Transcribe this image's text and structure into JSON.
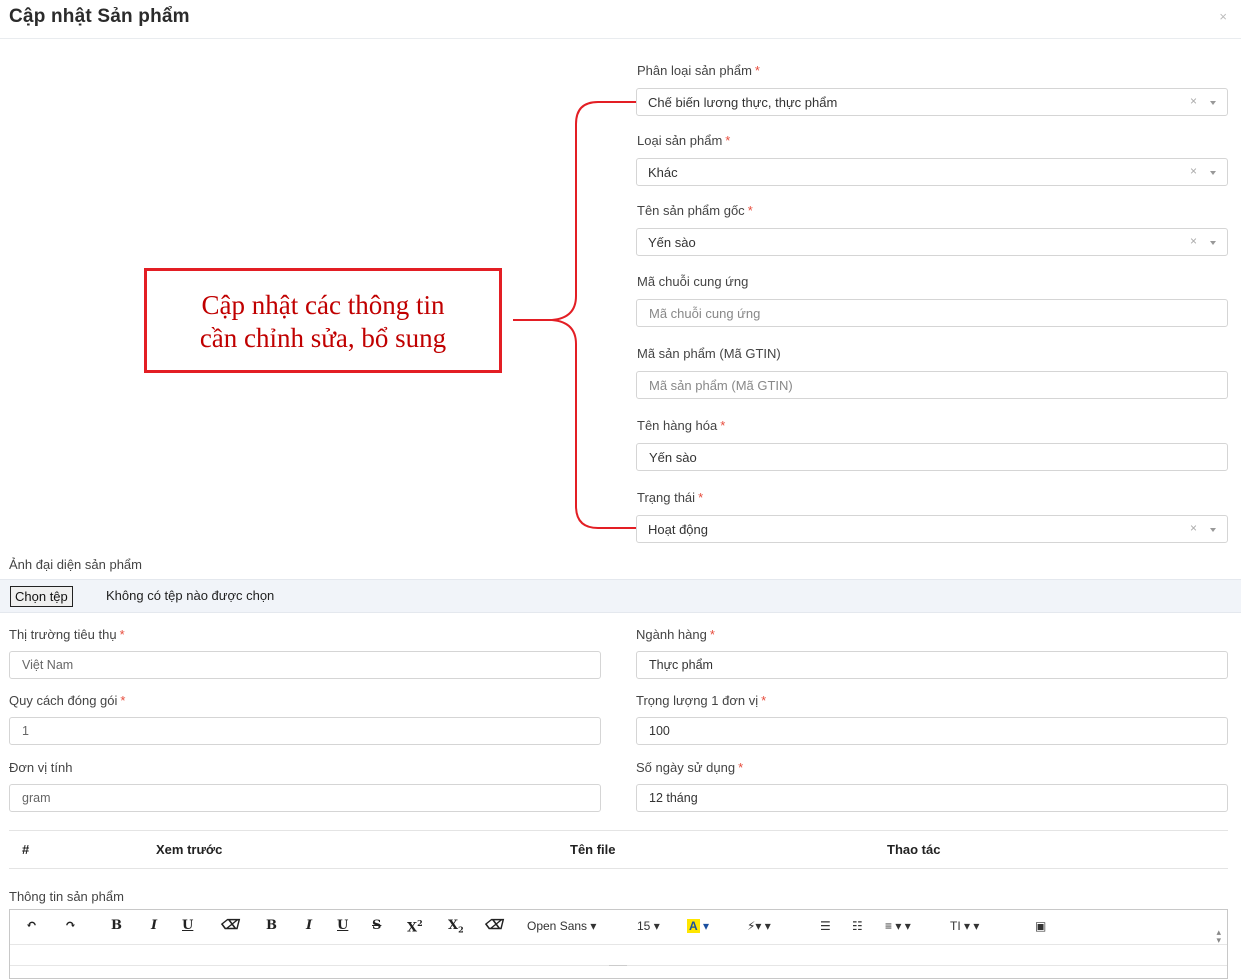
{
  "modal": {
    "title": "Cập nhật Sản phẩm",
    "close": "×"
  },
  "fields": {
    "category": {
      "label": "Phân loại sản phẩm",
      "value": "Chế biến lương thực, thực phẩm"
    },
    "type": {
      "label": "Loại sản phẩm",
      "value": "Khác"
    },
    "origin_name": {
      "label": "Tên sản phẩm gốc",
      "value": "Yến sào"
    },
    "supply_chain": {
      "label": "Mã chuỗi cung ứng",
      "placeholder": "Mã chuỗi cung ứng"
    },
    "gtin": {
      "label": "Mã sản phẩm (Mã GTIN)",
      "placeholder": "Mã sản phẩm (Mã GTIN)"
    },
    "goods_name": {
      "label": "Tên hàng hóa",
      "value": "Yến sào"
    },
    "status": {
      "label": "Trạng thái",
      "value": "Hoạt động"
    },
    "avatar": {
      "label": "Ảnh đại diện sản phẩm",
      "button": "Chọn tệp",
      "no_file": "Không có tệp nào được chọn"
    },
    "market": {
      "label": "Thị trường tiêu thụ",
      "value": "Việt Nam"
    },
    "industry": {
      "label": "Ngành hàng",
      "value": "Thực phẩm"
    },
    "packing": {
      "label": "Quy cách đóng gói",
      "value": "1"
    },
    "weight": {
      "label": "Trọng lượng 1 đơn vị",
      "value": "100"
    },
    "unit": {
      "label": "Đơn vị tính",
      "value": "gram"
    },
    "shelf_life": {
      "label": "Số ngày sử dụng",
      "value": "12 tháng"
    }
  },
  "required_mark": "*",
  "clear_mark": "×",
  "annotation": {
    "line1": "Cập nhật các thông tin",
    "line2": "cần chỉnh sửa, bổ sung",
    "color": "#e31e24"
  },
  "table": {
    "headers": [
      "#",
      "Xem trước",
      "Tên file",
      "Thao tác"
    ]
  },
  "editor": {
    "label": "Thông tin sản phẩm",
    "font_family": "Open Sans",
    "font_size": "15",
    "highlight_letter": "A",
    "text_size_btn": "TI"
  }
}
